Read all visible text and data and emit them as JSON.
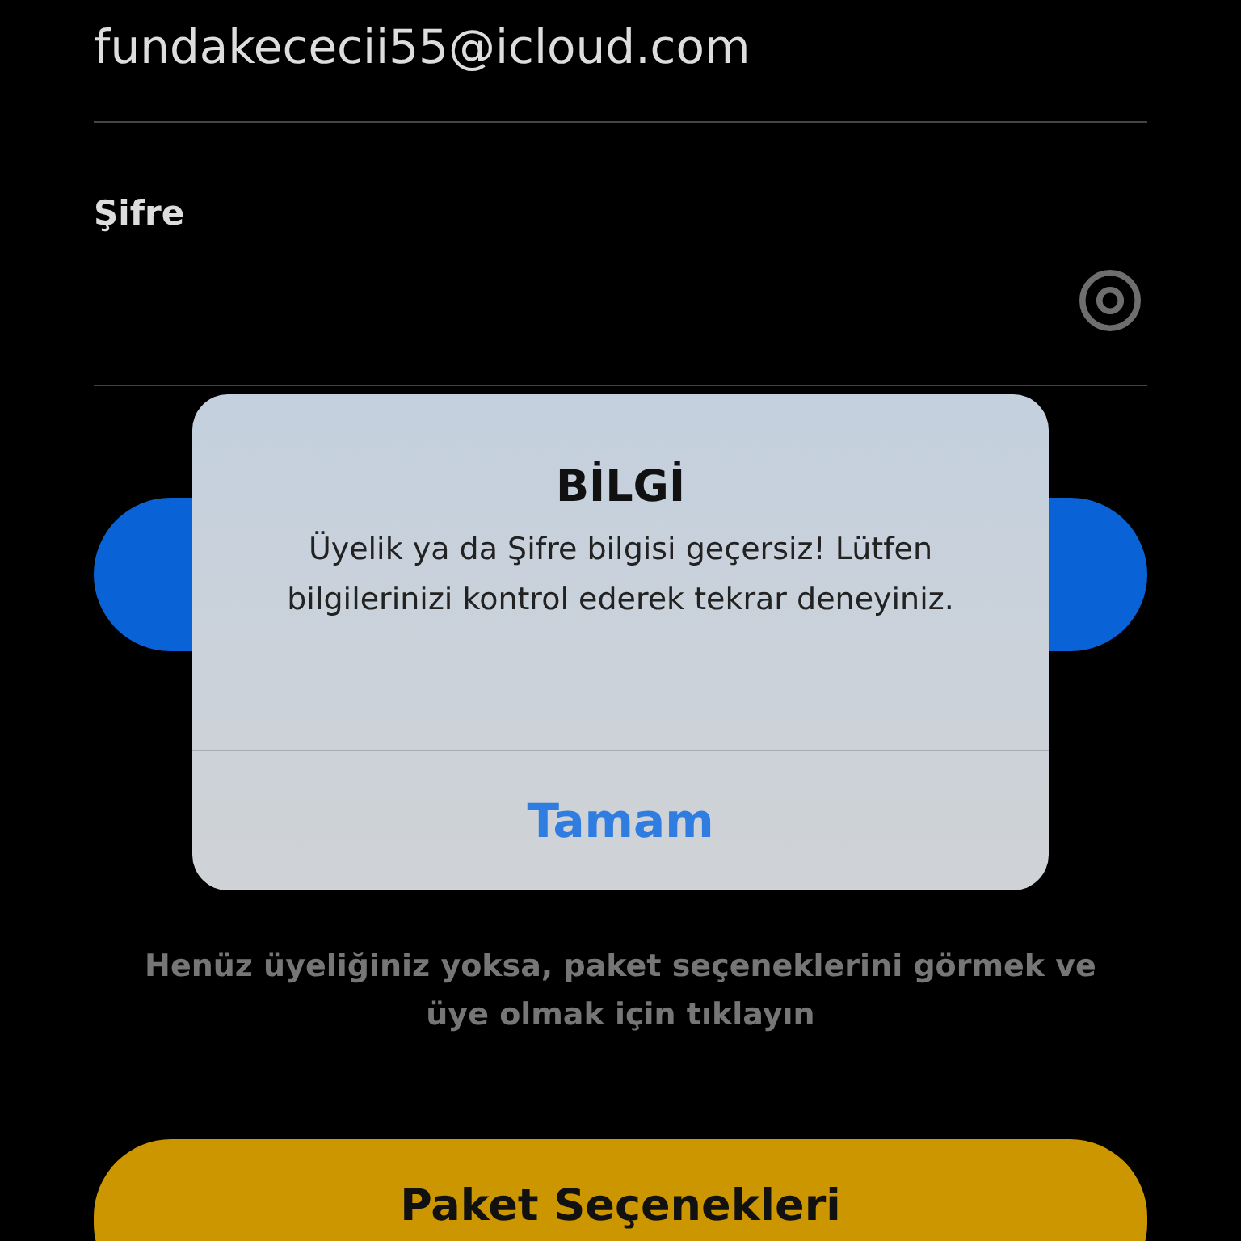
{
  "email_field": {
    "value": "fundakececii55@icloud.com"
  },
  "password_field": {
    "label": "Şifre"
  },
  "hint": "Henüz üyeliğiniz yoksa, paket seçeneklerini görmek ve üye olmak için tıklayın",
  "package_button": {
    "label": "Paket Seçenekleri"
  },
  "alert": {
    "title": "BİLGİ",
    "message": "Üyelik ya da Şifre bilgisi geçersiz! Lütfen bilgilerinizi kontrol ederek tekrar deneyiniz.",
    "buttons": [
      "Tamam"
    ]
  }
}
